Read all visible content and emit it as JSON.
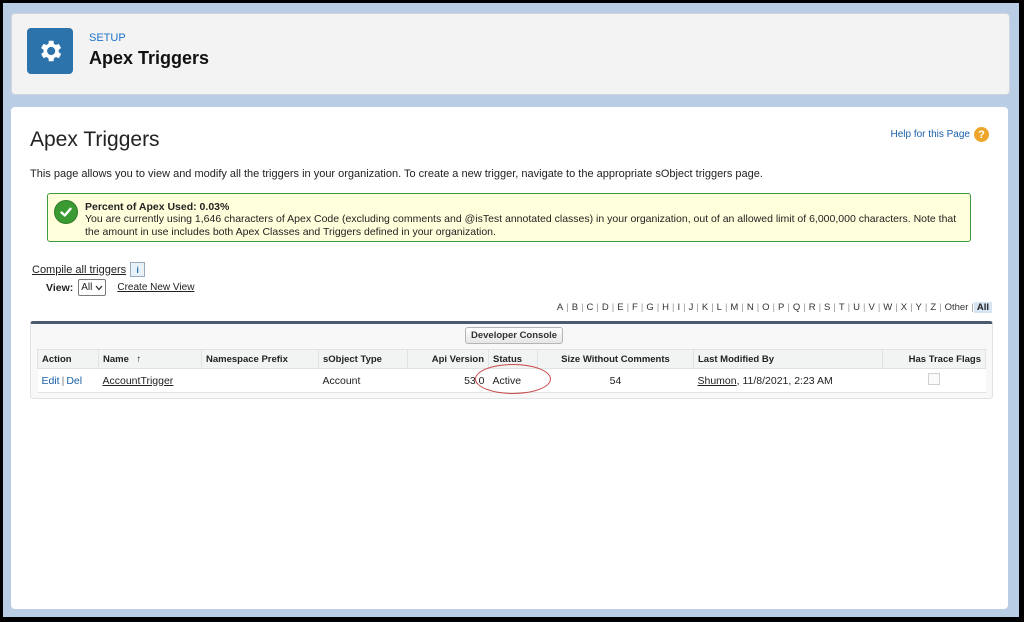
{
  "header": {
    "kicker": "SETUP",
    "title": "Apex Triggers"
  },
  "page": {
    "title": "Apex Triggers",
    "help_link": "Help for this Page",
    "help_icon_glyph": "?",
    "description": "This page allows you to view and modify all the triggers in your organization. To create a new trigger, navigate to the appropriate sObject triggers page."
  },
  "message": {
    "title": "Percent of Apex Used: 0.03%",
    "body": "You are currently using 1,646 characters of Apex Code (excluding comments and @isTest annotated classes) in your organization, out of an allowed limit of 6,000,000 characters. Note that the amount in use includes both Apex Classes and Triggers defined in your organization."
  },
  "toolbar": {
    "compile_link": "Compile all triggers",
    "info_glyph": "i",
    "view_label": "View:",
    "view_value": "All",
    "create_view": "Create New View"
  },
  "alphabet": [
    "A",
    "B",
    "C",
    "D",
    "E",
    "F",
    "G",
    "H",
    "I",
    "J",
    "K",
    "L",
    "M",
    "N",
    "O",
    "P",
    "Q",
    "R",
    "S",
    "T",
    "U",
    "V",
    "W",
    "X",
    "Y",
    "Z",
    "Other"
  ],
  "alphabet_selected": "All",
  "list": {
    "dev_console": "Developer Console",
    "columns": {
      "action": "Action",
      "name": "Name",
      "sort_glyph": "↑",
      "namespace": "Namespace Prefix",
      "sobject": "sObject Type",
      "api": "Api Version",
      "status": "Status",
      "size": "Size Without Comments",
      "modified": "Last Modified By",
      "trace": "Has Trace Flags"
    },
    "row": {
      "edit": "Edit",
      "del": "Del",
      "name": "AccountTrigger",
      "namespace": "",
      "sobject": "Account",
      "api": "53.0",
      "status": "Active",
      "size": "54",
      "modified_user": "Shumon",
      "modified_date": ", 11/8/2021, 2:23 AM"
    }
  },
  "colors": {
    "accent": "#2c73ac",
    "success": "#3b9b33",
    "annotation": "#c84a4a"
  }
}
